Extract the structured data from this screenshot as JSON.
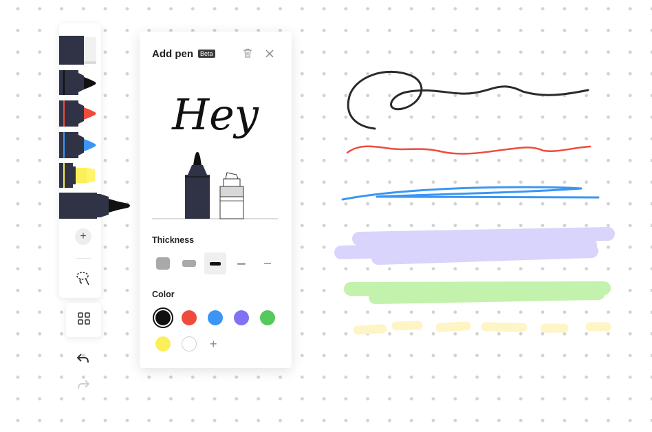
{
  "panel": {
    "title": "Add pen",
    "badge": "Beta",
    "preview_text": "Hey",
    "thickness_label": "Thickness",
    "color_label": "Color",
    "add_color_symbol": "+"
  },
  "toolbar": {
    "add_symbol": "+"
  },
  "icons": {
    "delete": "trash-icon",
    "close": "close-icon",
    "lasso": "lasso-icon",
    "grid": "grid-icon",
    "undo": "undo-icon",
    "redo": "redo-icon"
  },
  "colors": {
    "black": "#111111",
    "red": "#ef4b3d",
    "blue": "#3b96f3",
    "purple": "#8072f2",
    "green": "#55c95b",
    "yellow": "#fbef5a",
    "white": "#ffffff"
  }
}
